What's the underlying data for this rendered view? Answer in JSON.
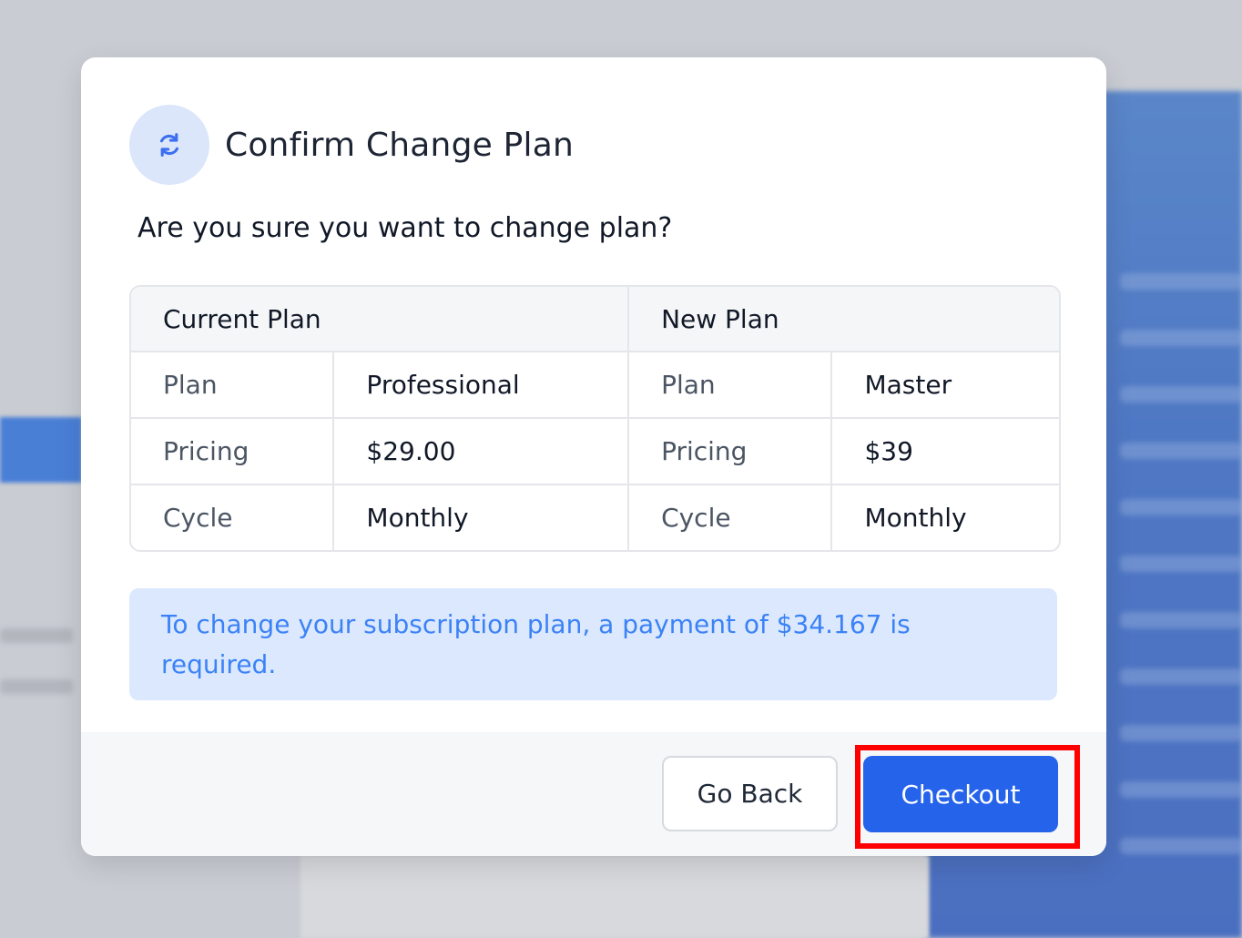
{
  "dialog": {
    "title": "Confirm Change Plan",
    "icon": "refresh-icon",
    "question": "Are you sure you want to change plan?",
    "table": {
      "headers": [
        "Current Plan",
        "New Plan"
      ],
      "rows": [
        {
          "current_label": "Plan",
          "current_value": "Professional",
          "new_label": "Plan",
          "new_value": "Master"
        },
        {
          "current_label": "Pricing",
          "current_value": "$29.00",
          "new_label": "Pricing",
          "new_value": "$39"
        },
        {
          "current_label": "Cycle",
          "current_value": "Monthly",
          "new_label": "Cycle",
          "new_value": "Monthly"
        }
      ]
    },
    "notice": "To change your subscription plan, a payment of $34.167 is required.",
    "buttons": {
      "back": "Go Back",
      "checkout": "Checkout"
    }
  },
  "colors": {
    "accent": "#2563eb",
    "notice_bg": "#dbe8fd",
    "notice_text": "#3b82f6",
    "highlight": "#ff0000"
  }
}
